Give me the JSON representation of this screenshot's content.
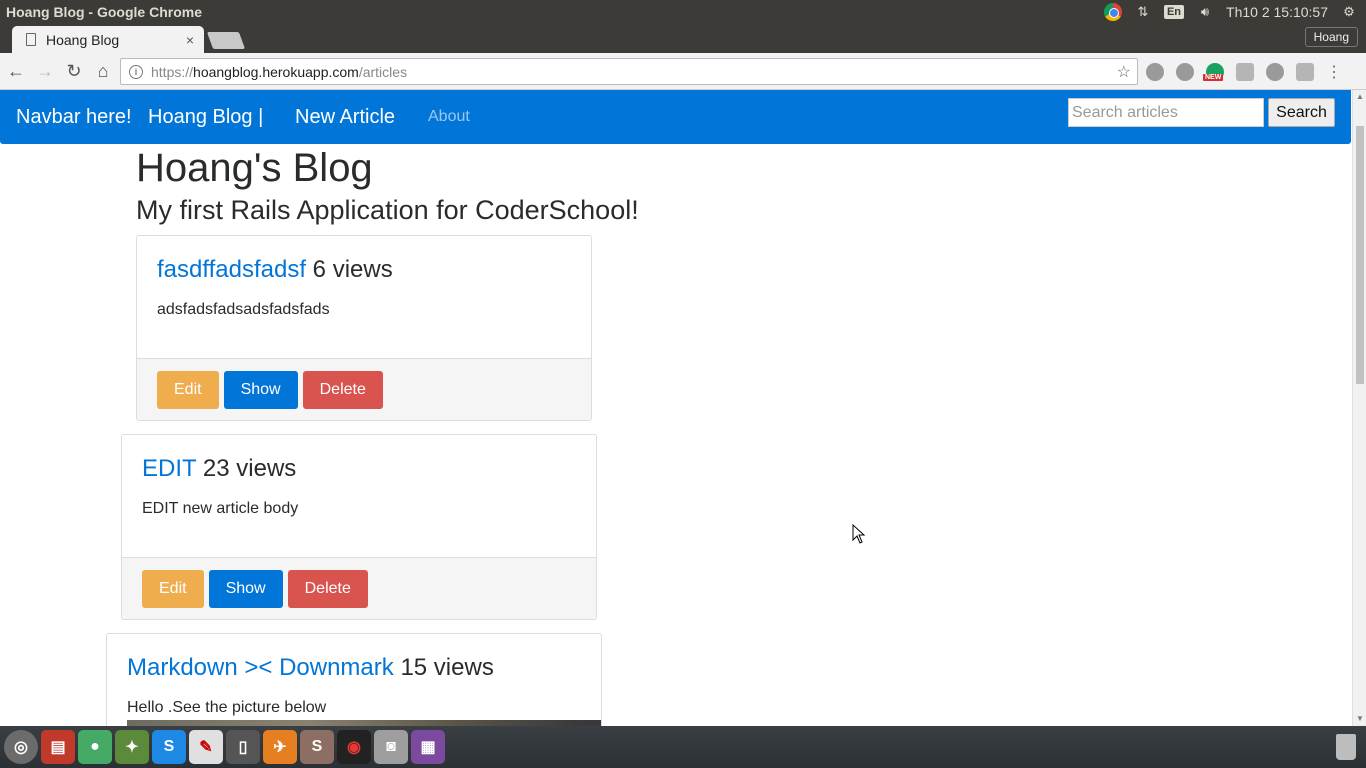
{
  "os": {
    "window_title": "Hoang Blog - Google Chrome",
    "lang": "En",
    "clock": "Th10  2 15:10:57"
  },
  "browser": {
    "tab_title": "Hoang Blog",
    "tab_close": "×",
    "profile": "Hoang",
    "url_scheme": "https://",
    "url_host": "hoangblog.herokuapp.com",
    "url_path": "/articles",
    "ext_badge": "NEW"
  },
  "navbar": {
    "brand": "Navbar here!",
    "blog_link": "Hoang Blog |",
    "new_article": "New Article",
    "about": "About",
    "search_placeholder": "Search articles",
    "search_button": "Search"
  },
  "page": {
    "title": "Hoang's Blog",
    "subtitle": "My first Rails Application for CoderSchool!"
  },
  "articles": [
    {
      "title": "fasdffadsfadsf",
      "views": "6 views",
      "body": "adsfadsfadsadsfadsfads",
      "edit": "Edit",
      "show": "Show",
      "delete": "Delete"
    },
    {
      "title": "EDIT",
      "views": "23 views",
      "body": "EDIT new article body",
      "edit": "Edit",
      "show": "Show",
      "delete": "Delete"
    },
    {
      "title": "Markdown >< Downmark",
      "views": "15 views",
      "body": "Hello .See the picture below"
    }
  ],
  "colors": {
    "navbar": "#0275d8",
    "link": "#0275d8",
    "edit_button": "#f0ad4e",
    "show_button": "#0275d8",
    "delete_button": "#d9534f"
  }
}
